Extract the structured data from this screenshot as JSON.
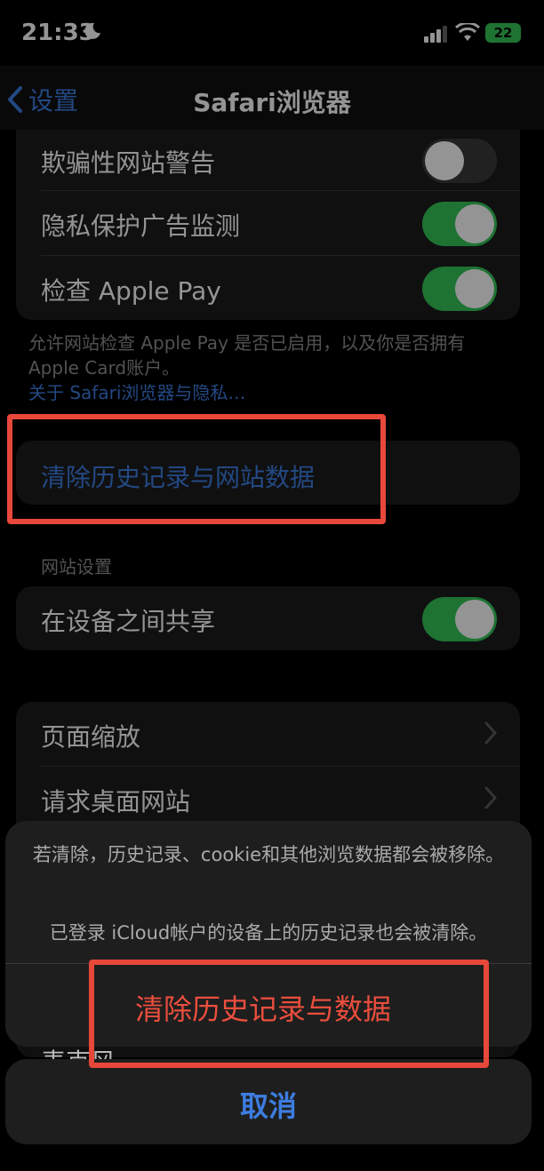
{
  "status_bar": {
    "time": "21:33",
    "battery": "22"
  },
  "nav": {
    "back_label": "设置",
    "title": "Safari浏览器"
  },
  "privacy_group": {
    "rows": [
      {
        "label": "欺骗性网站警告",
        "toggle": "off"
      },
      {
        "label": "隐私保护广告监测",
        "toggle": "on"
      },
      {
        "label": "检查 Apple Pay",
        "toggle": "on"
      }
    ],
    "footnote": "允许网站检查 Apple Pay 是否已启用，以及你是否拥有 Apple Card账户。",
    "link": "关于 Safari浏览器与隐私…"
  },
  "clear_history": {
    "label": "清除历史记录与网站数据"
  },
  "website_settings": {
    "header": "网站设置",
    "share_label": "在设备之间共享"
  },
  "more_group": {
    "rows": [
      "页面缩放",
      "请求桌面网站"
    ],
    "peek_label": "麦克风"
  },
  "action_sheet": {
    "message_line1": "若清除，历史记录、cookie和其他浏览数据都会被移除。",
    "message_line2": "已登录 iCloud帐户的设备上的历史记录也会被清除。",
    "destructive": "清除历史记录与数据",
    "cancel": "取消"
  },
  "colors": {
    "accent": "#3d7de0",
    "destructive": "#ea4e3d",
    "toggle_on": "#34c759",
    "highlight": "#e8483a"
  }
}
